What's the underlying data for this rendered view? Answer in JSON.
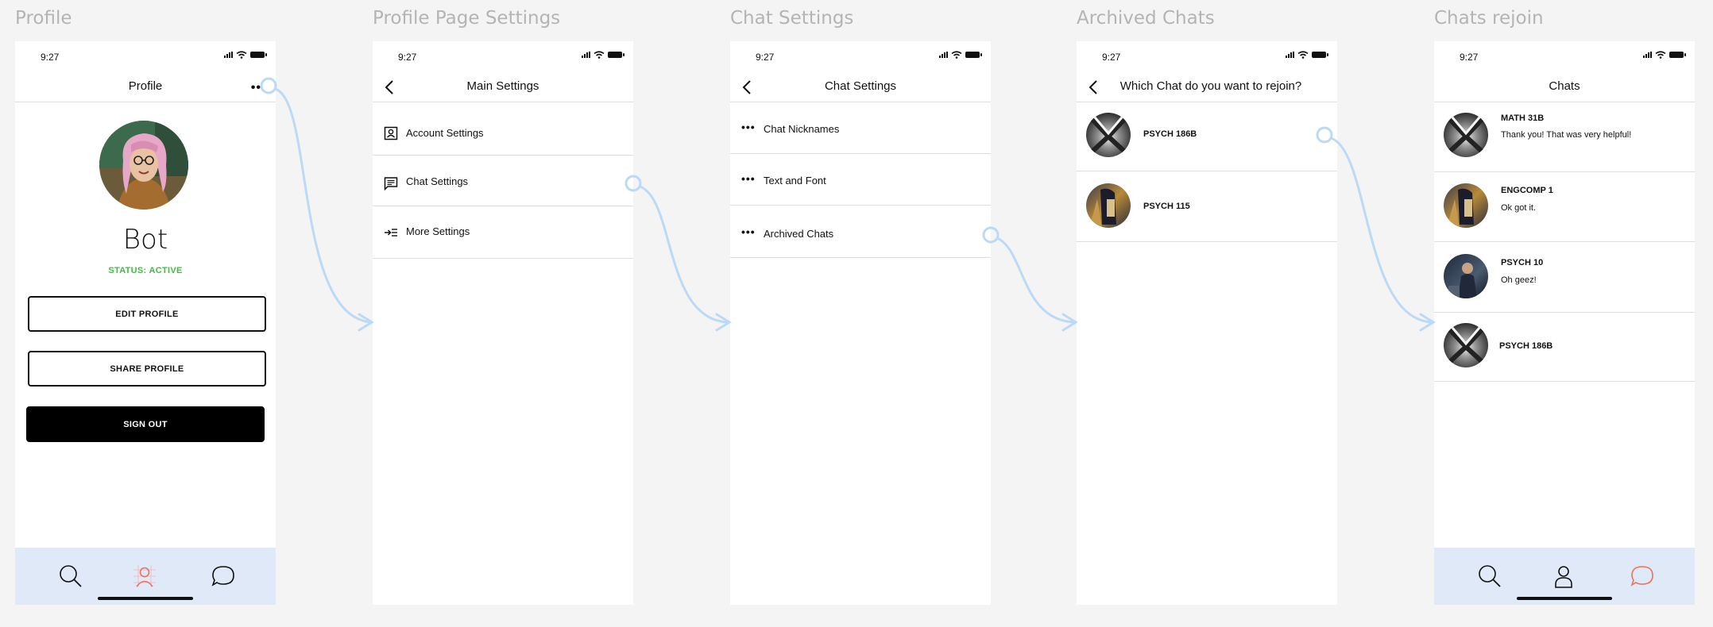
{
  "frames": {
    "profile": "Profile",
    "profile_settings": "Profile Page Settings",
    "chat_settings": "Chat Settings",
    "archived": "Archived Chats",
    "rejoin": "Chats rejoin"
  },
  "status_bar": {
    "time": "9:27"
  },
  "profile_screen": {
    "title": "Profile",
    "more": "••",
    "name": "Bot",
    "status": "STATUS: ACTIVE",
    "edit_button": "EDIT PROFILE",
    "share_button": "SHARE PROFILE",
    "signout_button": "SIGN OUT",
    "active_tab": "profile"
  },
  "main_settings": {
    "title": "Main Settings",
    "items": [
      {
        "label": "Account Settings",
        "icon": "account-icon"
      },
      {
        "label": "Chat Settings",
        "icon": "chat-bubble-icon"
      },
      {
        "label": "More Settings",
        "icon": "more-settings-icon"
      }
    ]
  },
  "chat_settings_screen": {
    "title": "Chat Settings",
    "items": [
      {
        "label": "Chat Nicknames"
      },
      {
        "label": "Text and Font"
      },
      {
        "label": "Archived Chats"
      }
    ]
  },
  "archived_screen": {
    "title": "Which Chat do you want to rejoin?",
    "items": [
      {
        "name": "PSYCH 186B"
      },
      {
        "name": "PSYCH 115"
      }
    ]
  },
  "chats_screen": {
    "title": "Chats",
    "items": [
      {
        "name": "MATH 31B",
        "message": "Thank you! That was very helpful!"
      },
      {
        "name": "ENGCOMP 1",
        "message": "Ok got it."
      },
      {
        "name": "PSYCH 10",
        "message": "Oh geez!"
      },
      {
        "name": "PSYCH 186B",
        "message": ""
      }
    ],
    "active_tab": "chats"
  },
  "colors": {
    "background": "#f4f4f4",
    "frame_title": "#b4b4b4",
    "tabbar": "#dfe9f7",
    "status_active": "#3ebd3e",
    "active_tab": "#e8735e",
    "connector": "#bcd9f5"
  }
}
